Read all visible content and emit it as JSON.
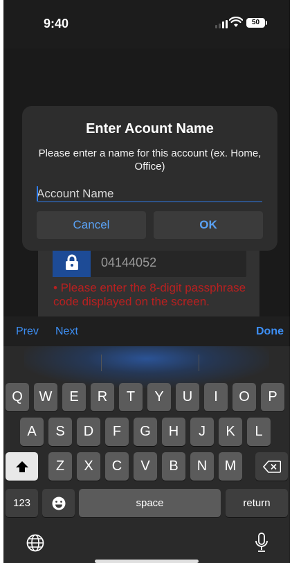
{
  "status_bar": {
    "time": "9:40",
    "battery": "50"
  },
  "background": {
    "passcode_value": "04144052",
    "error_message": "• Please enter the 8-digit passphrase code displayed on the screen."
  },
  "dialog": {
    "title": "Enter Acount Name",
    "message": "Please enter a name for this account (ex. Home, Office)",
    "input_placeholder": "Account Name",
    "input_value": "",
    "cancel_label": "Cancel",
    "ok_label": "OK"
  },
  "accessory_bar": {
    "prev": "Prev",
    "next": "Next",
    "done": "Done"
  },
  "keyboard": {
    "row1": [
      "Q",
      "W",
      "E",
      "R",
      "T",
      "Y",
      "U",
      "I",
      "O",
      "P"
    ],
    "row2": [
      "A",
      "S",
      "D",
      "F",
      "G",
      "H",
      "J",
      "K",
      "L"
    ],
    "row3": [
      "Z",
      "X",
      "C",
      "V",
      "B",
      "N",
      "M"
    ],
    "numbers_label": "123",
    "space_label": "space",
    "return_label": "return"
  },
  "colors": {
    "accent": "#3d8ff5",
    "error": "#b82020",
    "dialog_bg": "#2d2d2d"
  },
  "icons": [
    "lock-icon",
    "shift-icon",
    "backspace-icon",
    "emoji-icon",
    "globe-icon",
    "microphone-icon",
    "wifi-icon",
    "signal-icon",
    "battery-icon"
  ]
}
